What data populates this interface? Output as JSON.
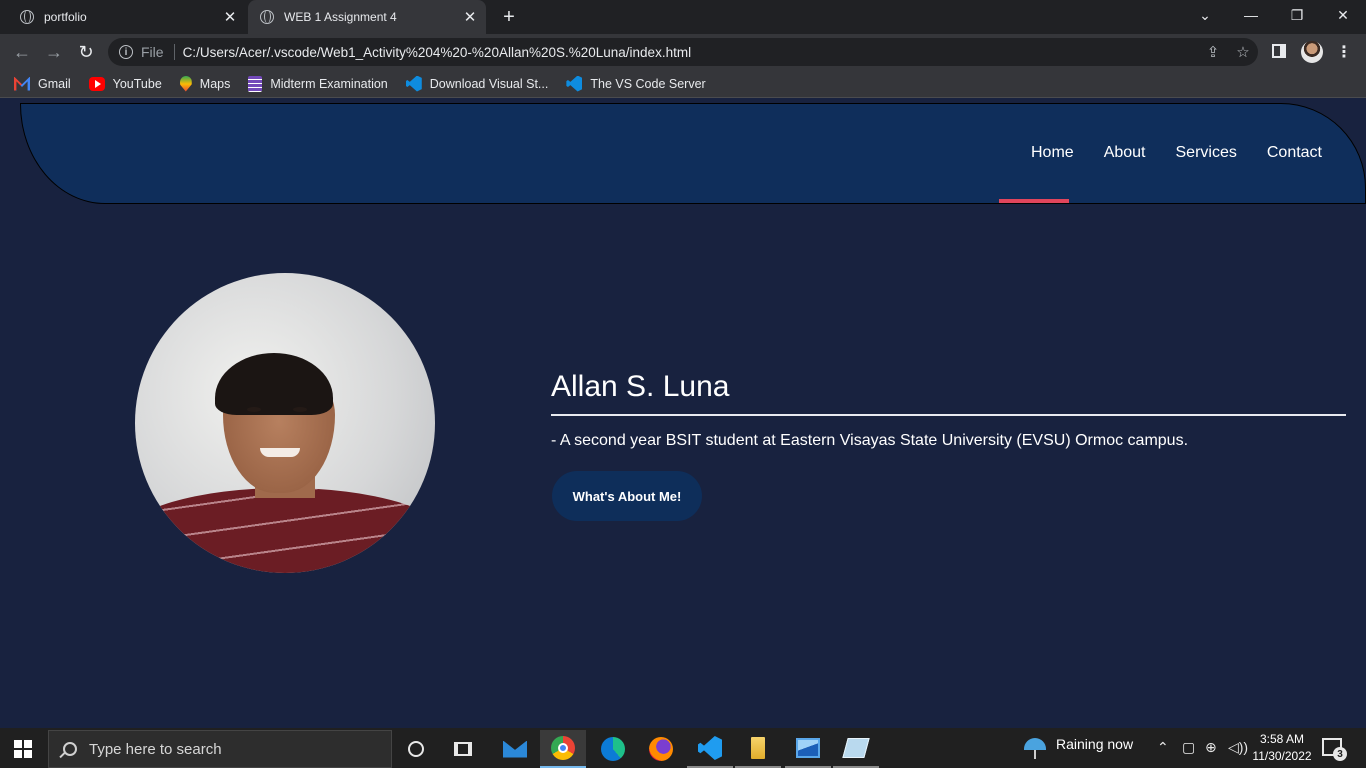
{
  "browser": {
    "tabs": [
      {
        "title": "portfolio",
        "active": false
      },
      {
        "title": "WEB 1 Assignment 4",
        "active": true
      }
    ],
    "new_tab_icon": "+",
    "window_controls": {
      "minimize": "—",
      "restore": "❐",
      "close": "✕",
      "tab_search": "⌄"
    },
    "address": {
      "scheme_label": "File",
      "url": "C:/Users/Acer/.vscode/Web1_Activity%204%20-%20Allan%20S.%20Luna/index.html"
    },
    "bookmarks": [
      {
        "label": "Gmail",
        "icon": "gmail-icon"
      },
      {
        "label": "YouTube",
        "icon": "youtube-icon"
      },
      {
        "label": "Maps",
        "icon": "maps-icon"
      },
      {
        "label": "Midterm Examination",
        "icon": "forms-icon"
      },
      {
        "label": "Download Visual St...",
        "icon": "vscode-icon"
      },
      {
        "label": "The VS Code Server",
        "icon": "vscode-icon"
      }
    ]
  },
  "site": {
    "nav": [
      "Home",
      "About",
      "Services",
      "Contact"
    ],
    "active_nav": "Home",
    "name": "Allan S. Luna",
    "tagline": "- A second year BSIT student at Eastern Visayas State University (EVSU) Ormoc campus.",
    "cta_label": "What's About Me!",
    "colors": {
      "background": "#18223f",
      "header": "#0f2e5b",
      "accent": "#e0455c",
      "button": "#0e2e5a"
    }
  },
  "taskbar": {
    "search_placeholder": "Type here to search",
    "weather": "Raining now",
    "time": "3:58 AM",
    "date": "11/30/2022",
    "notification_count": "3"
  }
}
